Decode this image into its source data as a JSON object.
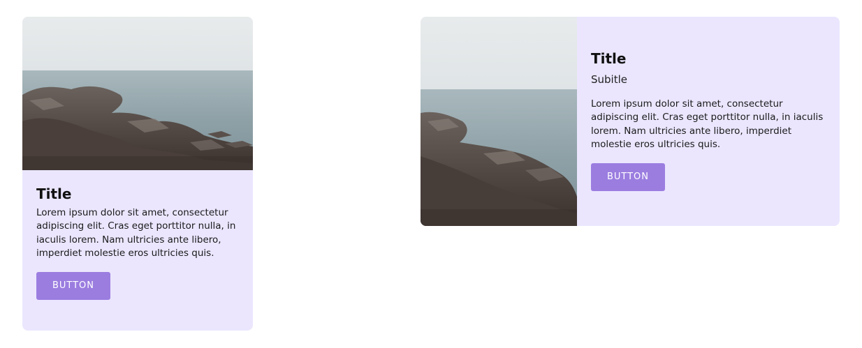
{
  "card_vertical": {
    "image": "rocky-coast-photo",
    "title": "Title",
    "description": "Lorem ipsum dolor sit amet, consectetur adipiscing elit. Cras eget porttitor nulla, in iaculis lorem. Nam ultricies ante libero, imperdiet molestie eros ultricies quis.",
    "button_label": "BUTTON"
  },
  "card_horizontal": {
    "image": "rocky-coast-photo",
    "title": "Title",
    "subtitle": "Subitle",
    "description": "Lorem ipsum dolor sit amet, consectetur adipiscing elit. Cras eget porttitor nulla, in iaculis lorem. Nam ultricies ante libero, imperdiet molestie eros ultricies quis.",
    "button_label": "BUTTON"
  },
  "colors": {
    "card_background": "#ebe6fe",
    "button_background": "#9b7de0",
    "button_text": "#ffffff"
  }
}
